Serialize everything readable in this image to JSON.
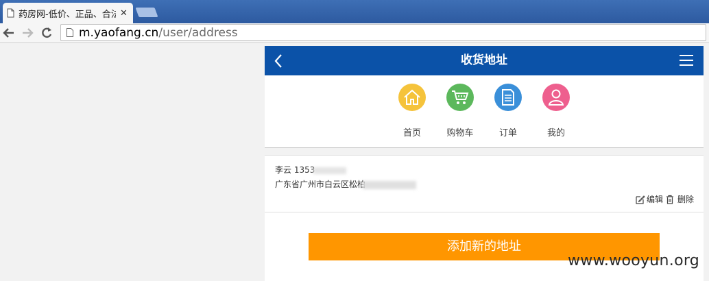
{
  "browser": {
    "tab_title": "药房网-低价、正品、合法",
    "url_host": "m.yaofang.cn",
    "url_path": "/user/address"
  },
  "page": {
    "title": "收货地址",
    "quick_nav": [
      {
        "label": "首页",
        "icon": "home-icon",
        "color": "#f5c33b"
      },
      {
        "label": "购物车",
        "icon": "cart-icon",
        "color": "#5cb85c"
      },
      {
        "label": "订单",
        "icon": "order-icon",
        "color": "#3a8fd9"
      },
      {
        "label": "我的",
        "icon": "user-icon",
        "color": "#ee5f8e"
      }
    ],
    "address": {
      "name_phone": "李云 1353",
      "address_text": "广东省广州市白云区松柏",
      "edit_label": "编辑",
      "delete_label": "删除"
    },
    "add_button_label": "添加新的地址"
  },
  "watermark": "www.wooyun.org",
  "colors": {
    "header_blue": "#0b52a8",
    "add_button_orange": "#ff9600"
  }
}
